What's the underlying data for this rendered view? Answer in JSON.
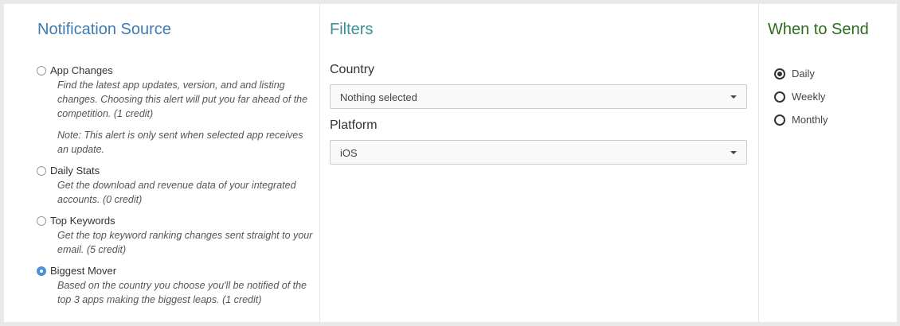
{
  "source": {
    "title": "Notification Source",
    "items": [
      {
        "label": "App Changes",
        "selected": false,
        "desc": "Find the latest app updates, version, and and listing changes. Choosing this alert will put you far ahead of the competition. (1 credit)",
        "note": "Note: This alert is only sent when selected app receives an update."
      },
      {
        "label": "Daily Stats",
        "selected": false,
        "desc": "Get the download and revenue data of your integrated accounts. (0 credit)"
      },
      {
        "label": "Top Keywords",
        "selected": false,
        "desc": "Get the top keyword ranking changes sent straight to your email. (5 credit)"
      },
      {
        "label": "Biggest Mover",
        "selected": true,
        "desc": "Based on the country you choose you'll be notified of the top 3 apps making the biggest leaps. (1 credit)"
      }
    ]
  },
  "filters": {
    "title": "Filters",
    "country_label": "Country",
    "country_value": "Nothing selected",
    "platform_label": "Platform",
    "platform_value": "iOS"
  },
  "when": {
    "title": "When to Send",
    "options": [
      {
        "label": "Daily",
        "selected": true
      },
      {
        "label": "Weekly",
        "selected": false
      },
      {
        "label": "Monthly",
        "selected": false
      }
    ]
  },
  "colors": {
    "source_title": "#3f7ab0",
    "filters_title": "#3b8f96",
    "when_title": "#2e6b1f",
    "radio_selected": "#4a90d9"
  }
}
